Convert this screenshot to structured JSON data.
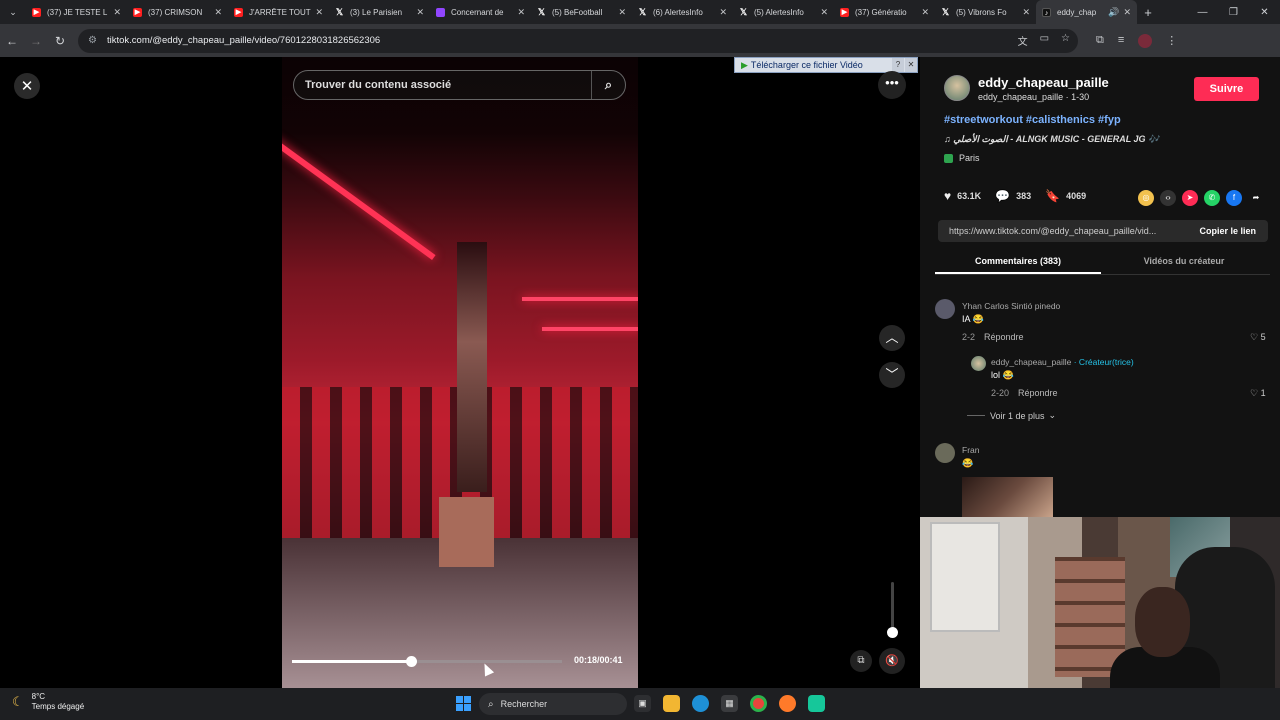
{
  "tabs": [
    {
      "title": "(37) JE TESTE L",
      "favicon": "youtube-icon"
    },
    {
      "title": "(37) CRIMSON",
      "favicon": "youtube-icon"
    },
    {
      "title": "J'ARRÊTE TOUT",
      "favicon": "youtube-icon"
    },
    {
      "title": "(3) Le Parisien",
      "favicon": "x-icon"
    },
    {
      "title": "Concernant de",
      "favicon": "twitch-icon"
    },
    {
      "title": "(5) BeFootball",
      "favicon": "x-icon"
    },
    {
      "title": "(6) AlertesInfo",
      "favicon": "x-icon"
    },
    {
      "title": "(5) AlertesInfo",
      "favicon": "x-icon"
    },
    {
      "title": "(37) Génératio",
      "favicon": "youtube-icon"
    },
    {
      "title": "(5) Vibrons Fo",
      "favicon": "x-icon"
    },
    {
      "title": "eddy_chap",
      "favicon": "tiktok-icon"
    }
  ],
  "address": {
    "url": "tiktok.com/@eddy_chapeau_paille/video/7601228031826562306"
  },
  "video": {
    "search_placeholder": "Trouver du contenu associé",
    "progress": 0.44,
    "time": "00:18/00:41",
    "download_label": "Télécharger ce fichier Vidéo"
  },
  "author": {
    "name": "eddy_chapeau_paille",
    "subline": "eddy_chapeau_paille · 1-30",
    "follow_label": "Suivre",
    "hashtags": "#streetworkout #calisthenics #fyp",
    "music_prefix": "♫",
    "music": "الصوت الأصلي - ALNGK MUSIC - GENERAL JG 🎶",
    "location": "Paris"
  },
  "stats": {
    "likes": "63.1K",
    "comments": "383",
    "saves": "4069"
  },
  "link": {
    "url": "https://www.tiktok.com/@eddy_chapeau_paille/vid...",
    "copy_label": "Copier le lien"
  },
  "panel_tabs": {
    "comments": "Commentaires (383)",
    "creator_videos": "Vidéos du créateur"
  },
  "comments": [
    {
      "name": "Yhan Carlos Sintió pinedo",
      "text": "IA 😂",
      "date": "2-2",
      "reply": "Répondre",
      "likes": "5"
    },
    {
      "name": "eddy_chapeau_paille",
      "badge": "· Créateur(trice)",
      "text": "lol 😂",
      "date": "2-20",
      "reply": "Répondre",
      "likes": "1"
    },
    {
      "name": "Fran",
      "text": "😂"
    }
  ],
  "more_replies": "Voir 1 de plus",
  "taskbar": {
    "temp": "8°C",
    "weather": "Temps dégagé",
    "search": "Rechercher"
  },
  "colors": {
    "accent": "#fe2c55",
    "hashtag": "#7cb3ff",
    "creator": "#25c3e8"
  }
}
